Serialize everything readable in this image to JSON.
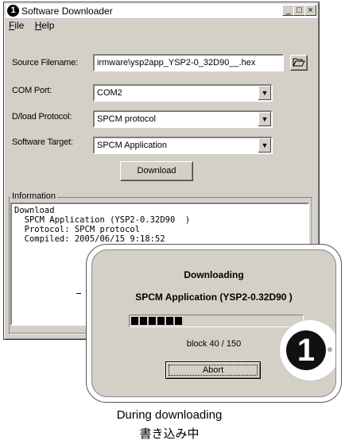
{
  "window": {
    "title": "Software Downloader",
    "icon_glyph": "1",
    "controls": {
      "minimize": "_",
      "maximize": "□",
      "close": "×"
    }
  },
  "menu": [
    {
      "key": "F",
      "rest": "ile"
    },
    {
      "key": "H",
      "rest": "elp"
    }
  ],
  "form": {
    "source_label": "Source Filename:",
    "source_value": "irmware\\ysp2app_YSP2-0_32D90__.hex",
    "com_label": "COM Port:",
    "com_value": "COM2",
    "protocol_label": "D/load Protocol:",
    "protocol_value": "SPCM protocol",
    "target_label": "Software Target:",
    "target_value": "SPCM Application",
    "download_button": "Download"
  },
  "information": {
    "title": "Information",
    "lines": [
      "Download",
      "  SPCM Application (YSP2-0.32D90  )",
      "  Protocol: SPCM protocol",
      "  Compiled: 2005/06/15 9:18:52"
    ]
  },
  "progress_dialog": {
    "title": "Downloading",
    "application": "SPCM Application (YSP2-0.32D90  )",
    "progress_fraction": 0.267,
    "filled_blocks": 6,
    "block_text": "block 40 / 150",
    "abort_button": "Abort",
    "logo_glyph": "1"
  },
  "captions": {
    "english": "During downloading",
    "japanese": "書き込み中"
  },
  "icons": {
    "app": "app-logo-icon",
    "browse": "folder-open-icon",
    "dropdown": "chevron-down-icon"
  }
}
